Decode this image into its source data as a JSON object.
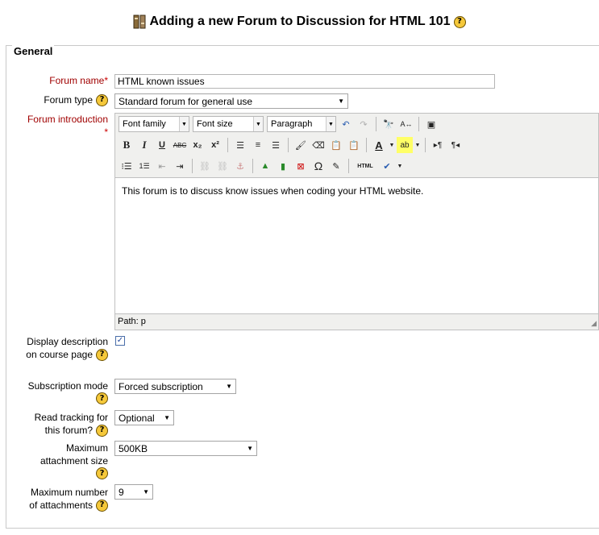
{
  "page": {
    "title": "Adding a new Forum to Discussion for HTML 101"
  },
  "section": {
    "legend": "General"
  },
  "fields": {
    "forum_name": {
      "label": "Forum name",
      "required": "*",
      "value": "HTML known issues"
    },
    "forum_type": {
      "label": "Forum type",
      "value": "Standard forum for general use"
    },
    "forum_intro": {
      "label": "Forum introduction",
      "required": "*"
    },
    "display_desc": {
      "label_line1": "Display description",
      "label_line2": "on course page",
      "checked": "✓"
    },
    "subscription": {
      "label": "Subscription mode",
      "value": "Forced subscription"
    },
    "read_tracking": {
      "label_line1": "Read tracking for",
      "label_line2": "this forum?",
      "value": "Optional"
    },
    "max_attach_size": {
      "label_line1": "Maximum",
      "label_line2": "attachment size",
      "value": "500KB"
    },
    "max_attach_num": {
      "label_line1": "Maximum number",
      "label_line2": "of attachments",
      "value": "9"
    }
  },
  "editor": {
    "font_family": "Font family",
    "font_size": "Font size",
    "format": "Paragraph",
    "content": "This forum is to discuss know issues when coding your HTML website.",
    "path": "Path: p",
    "buttons": {
      "bold": "B",
      "italic": "I",
      "underline": "U",
      "strike": "ABC",
      "sub": "x₂",
      "sup": "x²",
      "omega": "Ω",
      "html": "HTML"
    }
  },
  "colors": {
    "required": "#a00000",
    "help": "#f5c83a",
    "editor_bg": "#f0f0ee"
  }
}
